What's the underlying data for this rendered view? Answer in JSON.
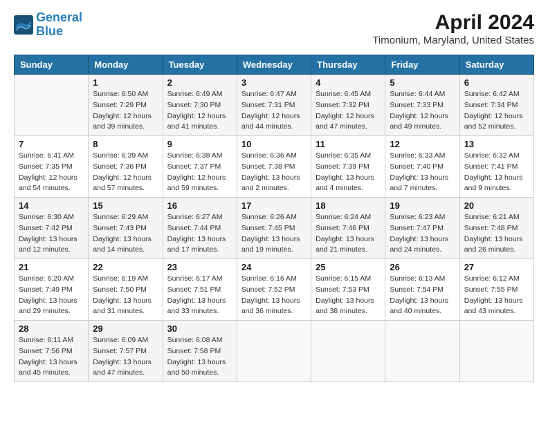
{
  "logo": {
    "text_general": "General",
    "text_blue": "Blue"
  },
  "title": "April 2024",
  "subtitle": "Timonium, Maryland, United States",
  "days_of_week": [
    "Sunday",
    "Monday",
    "Tuesday",
    "Wednesday",
    "Thursday",
    "Friday",
    "Saturday"
  ],
  "weeks": [
    [
      {
        "num": "",
        "info": ""
      },
      {
        "num": "1",
        "info": "Sunrise: 6:50 AM\nSunset: 7:29 PM\nDaylight: 12 hours\nand 39 minutes."
      },
      {
        "num": "2",
        "info": "Sunrise: 6:49 AM\nSunset: 7:30 PM\nDaylight: 12 hours\nand 41 minutes."
      },
      {
        "num": "3",
        "info": "Sunrise: 6:47 AM\nSunset: 7:31 PM\nDaylight: 12 hours\nand 44 minutes."
      },
      {
        "num": "4",
        "info": "Sunrise: 6:45 AM\nSunset: 7:32 PM\nDaylight: 12 hours\nand 47 minutes."
      },
      {
        "num": "5",
        "info": "Sunrise: 6:44 AM\nSunset: 7:33 PM\nDaylight: 12 hours\nand 49 minutes."
      },
      {
        "num": "6",
        "info": "Sunrise: 6:42 AM\nSunset: 7:34 PM\nDaylight: 12 hours\nand 52 minutes."
      }
    ],
    [
      {
        "num": "7",
        "info": "Sunrise: 6:41 AM\nSunset: 7:35 PM\nDaylight: 12 hours\nand 54 minutes."
      },
      {
        "num": "8",
        "info": "Sunrise: 6:39 AM\nSunset: 7:36 PM\nDaylight: 12 hours\nand 57 minutes."
      },
      {
        "num": "9",
        "info": "Sunrise: 6:38 AM\nSunset: 7:37 PM\nDaylight: 12 hours\nand 59 minutes."
      },
      {
        "num": "10",
        "info": "Sunrise: 6:36 AM\nSunset: 7:38 PM\nDaylight: 13 hours\nand 2 minutes."
      },
      {
        "num": "11",
        "info": "Sunrise: 6:35 AM\nSunset: 7:39 PM\nDaylight: 13 hours\nand 4 minutes."
      },
      {
        "num": "12",
        "info": "Sunrise: 6:33 AM\nSunset: 7:40 PM\nDaylight: 13 hours\nand 7 minutes."
      },
      {
        "num": "13",
        "info": "Sunrise: 6:32 AM\nSunset: 7:41 PM\nDaylight: 13 hours\nand 9 minutes."
      }
    ],
    [
      {
        "num": "14",
        "info": "Sunrise: 6:30 AM\nSunset: 7:42 PM\nDaylight: 13 hours\nand 12 minutes."
      },
      {
        "num": "15",
        "info": "Sunrise: 6:29 AM\nSunset: 7:43 PM\nDaylight: 13 hours\nand 14 minutes."
      },
      {
        "num": "16",
        "info": "Sunrise: 6:27 AM\nSunset: 7:44 PM\nDaylight: 13 hours\nand 17 minutes."
      },
      {
        "num": "17",
        "info": "Sunrise: 6:26 AM\nSunset: 7:45 PM\nDaylight: 13 hours\nand 19 minutes."
      },
      {
        "num": "18",
        "info": "Sunrise: 6:24 AM\nSunset: 7:46 PM\nDaylight: 13 hours\nand 21 minutes."
      },
      {
        "num": "19",
        "info": "Sunrise: 6:23 AM\nSunset: 7:47 PM\nDaylight: 13 hours\nand 24 minutes."
      },
      {
        "num": "20",
        "info": "Sunrise: 6:21 AM\nSunset: 7:48 PM\nDaylight: 13 hours\nand 26 minutes."
      }
    ],
    [
      {
        "num": "21",
        "info": "Sunrise: 6:20 AM\nSunset: 7:49 PM\nDaylight: 13 hours\nand 29 minutes."
      },
      {
        "num": "22",
        "info": "Sunrise: 6:19 AM\nSunset: 7:50 PM\nDaylight: 13 hours\nand 31 minutes."
      },
      {
        "num": "23",
        "info": "Sunrise: 6:17 AM\nSunset: 7:51 PM\nDaylight: 13 hours\nand 33 minutes."
      },
      {
        "num": "24",
        "info": "Sunrise: 6:16 AM\nSunset: 7:52 PM\nDaylight: 13 hours\nand 36 minutes."
      },
      {
        "num": "25",
        "info": "Sunrise: 6:15 AM\nSunset: 7:53 PM\nDaylight: 13 hours\nand 38 minutes."
      },
      {
        "num": "26",
        "info": "Sunrise: 6:13 AM\nSunset: 7:54 PM\nDaylight: 13 hours\nand 40 minutes."
      },
      {
        "num": "27",
        "info": "Sunrise: 6:12 AM\nSunset: 7:55 PM\nDaylight: 13 hours\nand 43 minutes."
      }
    ],
    [
      {
        "num": "28",
        "info": "Sunrise: 6:11 AM\nSunset: 7:56 PM\nDaylight: 13 hours\nand 45 minutes."
      },
      {
        "num": "29",
        "info": "Sunrise: 6:09 AM\nSunset: 7:57 PM\nDaylight: 13 hours\nand 47 minutes."
      },
      {
        "num": "30",
        "info": "Sunrise: 6:08 AM\nSunset: 7:58 PM\nDaylight: 13 hours\nand 50 minutes."
      },
      {
        "num": "",
        "info": ""
      },
      {
        "num": "",
        "info": ""
      },
      {
        "num": "",
        "info": ""
      },
      {
        "num": "",
        "info": ""
      }
    ]
  ]
}
